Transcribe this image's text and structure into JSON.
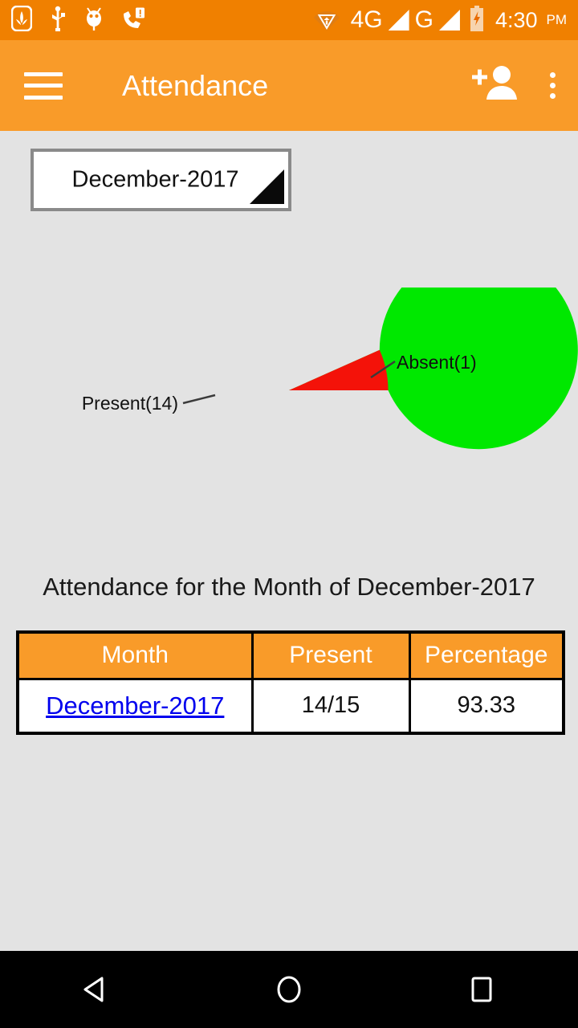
{
  "status_bar": {
    "background_color": "#F08000",
    "left_icons": [
      {
        "name": "app-notification-icon",
        "label": "app-badge"
      },
      {
        "name": "usb-icon",
        "label": "usb"
      },
      {
        "name": "android-debug-icon",
        "label": "android-debug"
      },
      {
        "name": "missed-call-icon",
        "label": "missed-call"
      }
    ],
    "right_icons": [
      {
        "name": "wifi-icon",
        "label": "wifi"
      },
      {
        "name": "signal-4g-icon",
        "label": "4G"
      },
      {
        "name": "signal-g-icon",
        "label": "G"
      },
      {
        "name": "battery-charging-icon",
        "label": "battery"
      }
    ],
    "network_1": "4G",
    "network_2": "G",
    "time": "4:30",
    "ampm": "PM"
  },
  "app_bar": {
    "background_color": "#F99B29",
    "title": "Attendance",
    "menu_icon": "hamburger-icon",
    "add_user_icon": "add-person-icon",
    "overflow_icon": "overflow-menu-icon"
  },
  "spinner": {
    "selected": "December-2017",
    "arrow_icon": "dropdown-triangle-icon"
  },
  "chart_data": {
    "type": "pie",
    "title": "",
    "labels": [
      "Present(14)",
      "Absent(1)"
    ],
    "values": [
      14,
      1
    ],
    "colors": [
      "#00E800",
      "#F41209"
    ],
    "percentages": [
      93.33,
      6.67
    ],
    "legend": "callout-labels",
    "label_left": "Present(14)",
    "label_right": "Absent(1)",
    "total": 15
  },
  "heading": {
    "text": "Attendance for the Month of December-2017"
  },
  "table": {
    "headers": [
      "Month",
      "Present",
      "Percentage"
    ],
    "header_bg": "#F99B29",
    "rows": [
      {
        "month": "December-2017",
        "present": "14/15",
        "percentage": "93.33",
        "month_is_link": true
      }
    ]
  },
  "nav_bar": {
    "back_icon": "back-triangle-icon",
    "home_icon": "home-circle-icon",
    "recents_icon": "recents-square-icon"
  }
}
